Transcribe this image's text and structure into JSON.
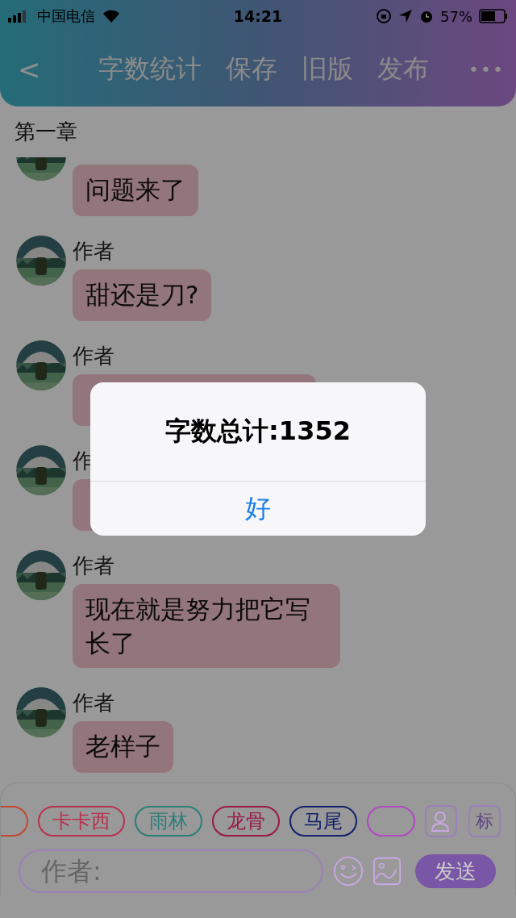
{
  "status_bar": {
    "carrier": "中国电信",
    "time": "14:21",
    "battery": "57%"
  },
  "header": {
    "back": "<",
    "actions": [
      "字数统计",
      "保存",
      "旧版",
      "发布"
    ],
    "more": "•••"
  },
  "chapter": {
    "title": "第一章"
  },
  "messages": [
    {
      "text": "问题来了"
    },
    {
      "name": "作者",
      "text": "甜还是刀?"
    },
    {
      "name": "作者"
    },
    {
      "name": "作"
    },
    {
      "name": "作者",
      "text": "现在就是努力把它写长了"
    },
    {
      "name": "作者",
      "text": "老样子"
    }
  ],
  "tags": [
    {
      "color": "#c04830"
    },
    {
      "label": "卡卡西",
      "color": "#b8324e"
    },
    {
      "label": "雨林",
      "color": "#2a7e78"
    },
    {
      "label": "龙骨",
      "color": "#9a1848"
    },
    {
      "label": "马尾",
      "color": "#10206a"
    },
    {
      "color": "#b048c0"
    }
  ],
  "tag_tools": {
    "mark": "标"
  },
  "composer": {
    "placeholder": "作者:",
    "send": "发送"
  },
  "alert": {
    "message": "字数总计:1352",
    "button": "好"
  }
}
